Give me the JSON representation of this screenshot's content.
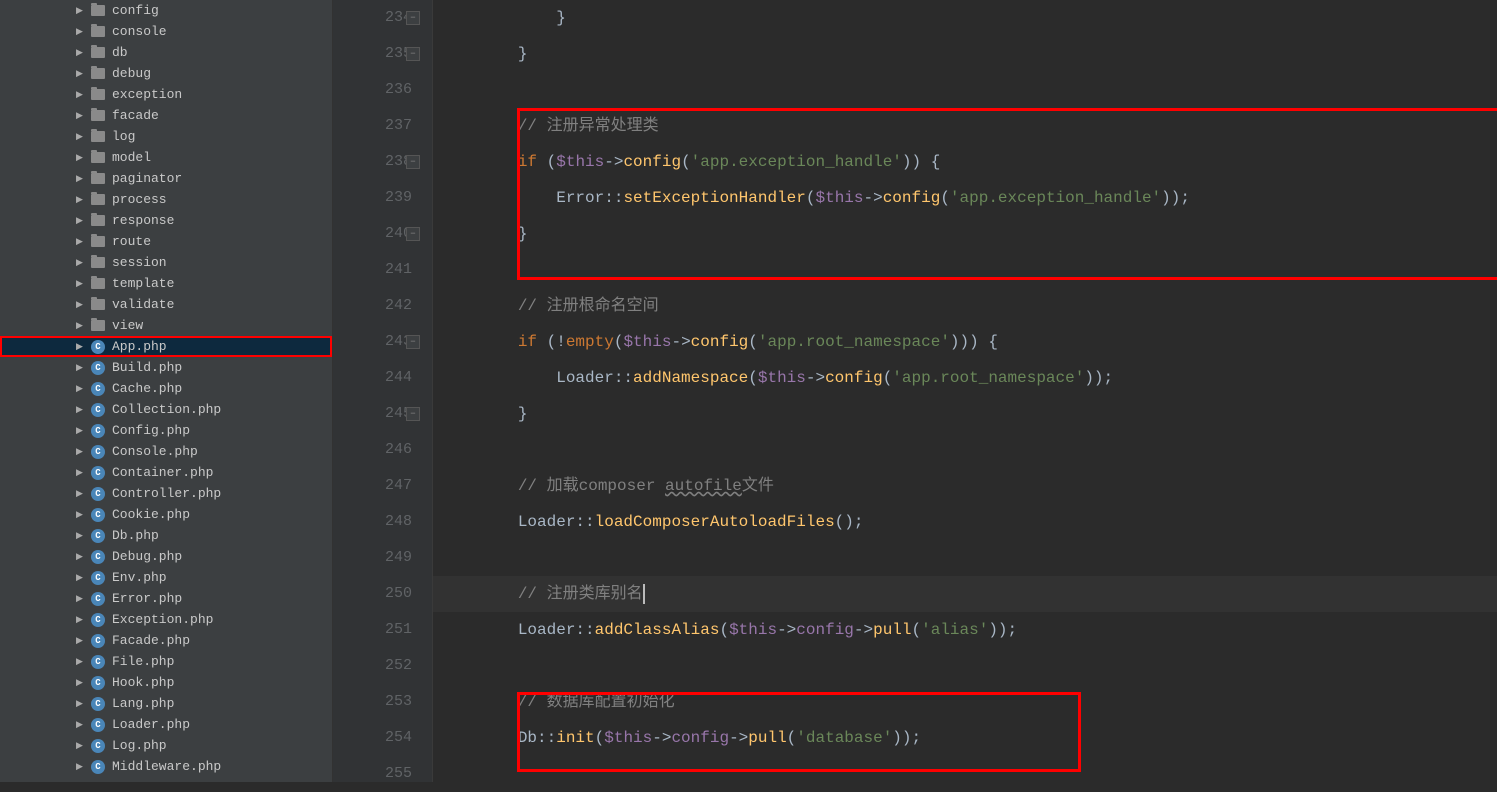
{
  "sidebar": {
    "folders": [
      "config",
      "console",
      "db",
      "debug",
      "exception",
      "facade",
      "log",
      "model",
      "paginator",
      "process",
      "response",
      "route",
      "session",
      "template",
      "validate",
      "view"
    ],
    "files": [
      "App.php",
      "Build.php",
      "Cache.php",
      "Collection.php",
      "Config.php",
      "Console.php",
      "Container.php",
      "Controller.php",
      "Cookie.php",
      "Db.php",
      "Debug.php",
      "Env.php",
      "Error.php",
      "Exception.php",
      "Facade.php",
      "File.php",
      "Hook.php",
      "Lang.php",
      "Loader.php",
      "Log.php",
      "Middleware.php"
    ],
    "selected": "App.php"
  },
  "editor": {
    "startLine": 234,
    "currentLine": 250,
    "icon_glyph": "C",
    "lines": [
      {
        "n": 234,
        "fold": "minus",
        "tokens": [
          {
            "t": "            }",
            "c": "paren"
          }
        ]
      },
      {
        "n": 235,
        "fold": "minus",
        "tokens": [
          {
            "t": "        }",
            "c": "paren"
          }
        ]
      },
      {
        "n": 236,
        "tokens": []
      },
      {
        "n": 237,
        "tokens": [
          {
            "t": "        ",
            "c": "op"
          },
          {
            "t": "// 注册异常处理类",
            "c": "comment"
          }
        ]
      },
      {
        "n": 238,
        "fold": "minus",
        "tokens": [
          {
            "t": "        ",
            "c": "op"
          },
          {
            "t": "if ",
            "c": "kw"
          },
          {
            "t": "(",
            "c": "paren"
          },
          {
            "t": "$this",
            "c": "var"
          },
          {
            "t": "->",
            "c": "op"
          },
          {
            "t": "config",
            "c": "method"
          },
          {
            "t": "(",
            "c": "paren"
          },
          {
            "t": "'app.exception_handle'",
            "c": "str"
          },
          {
            "t": ")) {",
            "c": "paren"
          }
        ]
      },
      {
        "n": 239,
        "tokens": [
          {
            "t": "            Error",
            "c": "class"
          },
          {
            "t": "::",
            "c": "op"
          },
          {
            "t": "setExceptionHandler",
            "c": "method"
          },
          {
            "t": "(",
            "c": "paren"
          },
          {
            "t": "$this",
            "c": "var"
          },
          {
            "t": "->",
            "c": "op"
          },
          {
            "t": "config",
            "c": "method"
          },
          {
            "t": "(",
            "c": "paren"
          },
          {
            "t": "'app.exception_handle'",
            "c": "str"
          },
          {
            "t": "));",
            "c": "paren"
          }
        ]
      },
      {
        "n": 240,
        "fold": "minus",
        "tokens": [
          {
            "t": "        }",
            "c": "paren"
          }
        ]
      },
      {
        "n": 241,
        "tokens": []
      },
      {
        "n": 242,
        "tokens": [
          {
            "t": "        ",
            "c": "op"
          },
          {
            "t": "// 注册根命名空间",
            "c": "comment"
          }
        ]
      },
      {
        "n": 243,
        "fold": "minus",
        "tokens": [
          {
            "t": "        ",
            "c": "op"
          },
          {
            "t": "if ",
            "c": "kw"
          },
          {
            "t": "(!",
            "c": "paren"
          },
          {
            "t": "empty",
            "c": "kw"
          },
          {
            "t": "(",
            "c": "paren"
          },
          {
            "t": "$this",
            "c": "var"
          },
          {
            "t": "->",
            "c": "op"
          },
          {
            "t": "config",
            "c": "method"
          },
          {
            "t": "(",
            "c": "paren"
          },
          {
            "t": "'app.root_namespace'",
            "c": "str"
          },
          {
            "t": "))) {",
            "c": "paren"
          }
        ]
      },
      {
        "n": 244,
        "tokens": [
          {
            "t": "            Loader",
            "c": "class"
          },
          {
            "t": "::",
            "c": "op"
          },
          {
            "t": "addNamespace",
            "c": "method"
          },
          {
            "t": "(",
            "c": "paren"
          },
          {
            "t": "$this",
            "c": "var"
          },
          {
            "t": "->",
            "c": "op"
          },
          {
            "t": "config",
            "c": "method"
          },
          {
            "t": "(",
            "c": "paren"
          },
          {
            "t": "'app.root_namespace'",
            "c": "str"
          },
          {
            "t": "));",
            "c": "paren"
          }
        ]
      },
      {
        "n": 245,
        "fold": "minus",
        "tokens": [
          {
            "t": "        }",
            "c": "paren"
          }
        ]
      },
      {
        "n": 246,
        "tokens": []
      },
      {
        "n": 247,
        "tokens": [
          {
            "t": "        ",
            "c": "op"
          },
          {
            "t": "// 加载composer ",
            "c": "comment"
          },
          {
            "t": "autofile",
            "c": "comment underline"
          },
          {
            "t": "文件",
            "c": "comment"
          }
        ]
      },
      {
        "n": 248,
        "tokens": [
          {
            "t": "        Loader",
            "c": "class"
          },
          {
            "t": "::",
            "c": "op"
          },
          {
            "t": "loadComposerAutoloadFiles",
            "c": "method"
          },
          {
            "t": "();",
            "c": "paren"
          }
        ]
      },
      {
        "n": 249,
        "tokens": []
      },
      {
        "n": 250,
        "current": true,
        "tokens": [
          {
            "t": "        ",
            "c": "op"
          },
          {
            "t": "// 注册类库别名",
            "c": "comment"
          }
        ],
        "caret": true
      },
      {
        "n": 251,
        "tokens": [
          {
            "t": "        Loader",
            "c": "class"
          },
          {
            "t": "::",
            "c": "op"
          },
          {
            "t": "addClassAlias",
            "c": "method"
          },
          {
            "t": "(",
            "c": "paren"
          },
          {
            "t": "$this",
            "c": "var"
          },
          {
            "t": "->",
            "c": "op"
          },
          {
            "t": "config",
            "c": "var"
          },
          {
            "t": "->",
            "c": "op"
          },
          {
            "t": "pull",
            "c": "method"
          },
          {
            "t": "(",
            "c": "paren"
          },
          {
            "t": "'alias'",
            "c": "str"
          },
          {
            "t": "));",
            "c": "paren"
          }
        ]
      },
      {
        "n": 252,
        "tokens": []
      },
      {
        "n": 253,
        "tokens": [
          {
            "t": "        ",
            "c": "op"
          },
          {
            "t": "// 数据库配置初始化",
            "c": "comment"
          }
        ]
      },
      {
        "n": 254,
        "tokens": [
          {
            "t": "        Db",
            "c": "class"
          },
          {
            "t": "::",
            "c": "op"
          },
          {
            "t": "init",
            "c": "method"
          },
          {
            "t": "(",
            "c": "paren"
          },
          {
            "t": "$this",
            "c": "var"
          },
          {
            "t": "->",
            "c": "op"
          },
          {
            "t": "config",
            "c": "var"
          },
          {
            "t": "->",
            "c": "op"
          },
          {
            "t": "pull",
            "c": "method"
          },
          {
            "t": "(",
            "c": "paren"
          },
          {
            "t": "'database'",
            "c": "str"
          },
          {
            "t": "));",
            "c": "paren"
          }
        ]
      },
      {
        "n": 255,
        "tokens": []
      }
    ]
  }
}
